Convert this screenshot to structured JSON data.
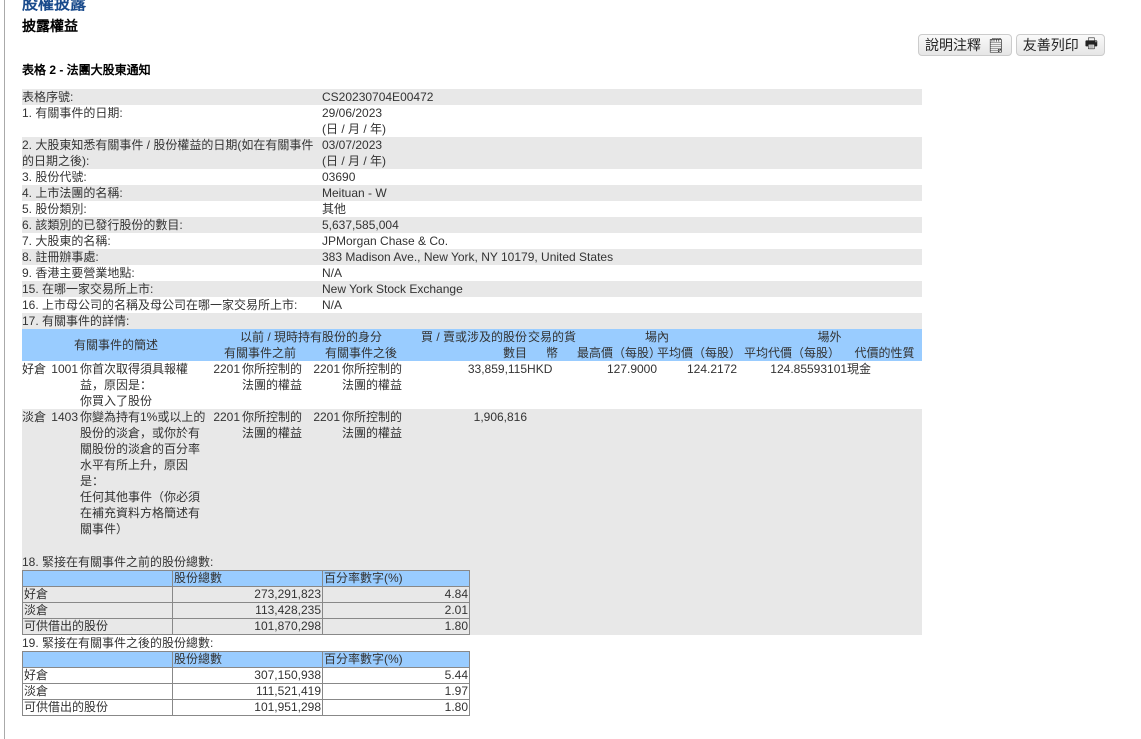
{
  "page": {
    "top_title": "股權披露",
    "subtitle": "披露權益",
    "form_title": "表格 2 - 法團大股東通知"
  },
  "buttons": {
    "notes": "說明注釋",
    "print": "友善列印"
  },
  "fields": [
    {
      "label": "表格序號:",
      "value": [
        "CS20230704E00472"
      ]
    },
    {
      "label": "1. 有關事件的日期:",
      "value": [
        "29/06/2023",
        "(日 / 月 / 年)"
      ]
    },
    {
      "label": "2. 大股東知悉有關事件 / 股份權益的日期(如在有關事件的日期之後):",
      "value": [
        "03/07/2023",
        "(日 / 月 / 年)"
      ]
    },
    {
      "label": "3. 股份代號:",
      "value": [
        "03690"
      ]
    },
    {
      "label": "4. 上市法團的名稱:",
      "value": [
        "Meituan - W"
      ]
    },
    {
      "label": "5. 股份類別:",
      "value": [
        "其他"
      ]
    },
    {
      "label": "6. 該類別的已發行股份的數目:",
      "value": [
        "5,637,585,004"
      ]
    },
    {
      "label": "7. 大股東的名稱:",
      "value": [
        "JPMorgan Chase & Co."
      ]
    },
    {
      "label": "8. 註冊辦事處:",
      "value": [
        "383 Madison Ave., New York, NY 10179, United States"
      ]
    },
    {
      "label": "9. 香港主要營業地點:",
      "value": [
        "N/A"
      ]
    },
    {
      "label": "15. 在哪一家交易所上市:",
      "value": [
        "New York Stock Exchange"
      ]
    },
    {
      "label": "16. 上市母公司的名稱及母公司在哪一家交易所上市:",
      "value": [
        "N/A"
      ]
    },
    {
      "label": "17. 有關事件的詳情:",
      "value": []
    }
  ],
  "event_table": {
    "headers": {
      "desc": "有關事件的簡述",
      "capacity": "以前 / 現時持有股份的身分",
      "before": "有關事件之前",
      "after": "有關事件之後",
      "shares": "買 / 賣或涉及的股份數目",
      "currency": "交易的貨幣",
      "on_exchange": "場內",
      "highest": "最高價（每股）",
      "average": "平均價（每股）",
      "off_exchange": "場外",
      "off_average": "平均代價（每股）",
      "nature": "代價的性質"
    },
    "rows": [
      {
        "position": "好倉",
        "code": "1001",
        "desc": "你首次取得須具報權益，原因是：\n你買入了股份",
        "before_code": "2201",
        "before": "你所控制的法團的權益",
        "after_code": "2201",
        "after": "你所控制的法團的權益",
        "shares": "33,859,115",
        "currency": "HKD",
        "highest": "127.9000",
        "average": "124.2172",
        "off_average": "124.85593101",
        "nature": "現金"
      },
      {
        "position": "淡倉",
        "code": "1403",
        "desc": "你變為持有1%或以上的股份的淡倉，或你於有關股份的淡倉的百分率水平有所上升，原因是：\n任何其他事件（你必須在補充資料方格簡述有關事件）",
        "before_code": "2201",
        "before": "你所控制的法團的權益",
        "after_code": "2201",
        "after": "你所控制的法團的權益",
        "shares": "1,906,816",
        "currency": "",
        "highest": "",
        "average": "",
        "off_average": "",
        "nature": ""
      }
    ]
  },
  "sec18": {
    "title": "18. 緊接在有關事件之前的股份總數:",
    "col1": "股份總數",
    "col2": "百分率數字(%)",
    "rows": [
      [
        "好倉",
        "273,291,823",
        "4.84"
      ],
      [
        "淡倉",
        "113,428,235",
        "2.01"
      ],
      [
        "可供借出的股份",
        "101,870,298",
        "1.80"
      ]
    ]
  },
  "sec19": {
    "title": "19. 緊接在有關事件之後的股份總數:",
    "col1": "股份總數",
    "col2": "百分率數字(%)",
    "rows": [
      [
        "好倉",
        "307,150,938",
        "5.44"
      ],
      [
        "淡倉",
        "111,521,419",
        "1.97"
      ],
      [
        "可供借出的股份",
        "101,951,298",
        "1.80"
      ]
    ]
  }
}
